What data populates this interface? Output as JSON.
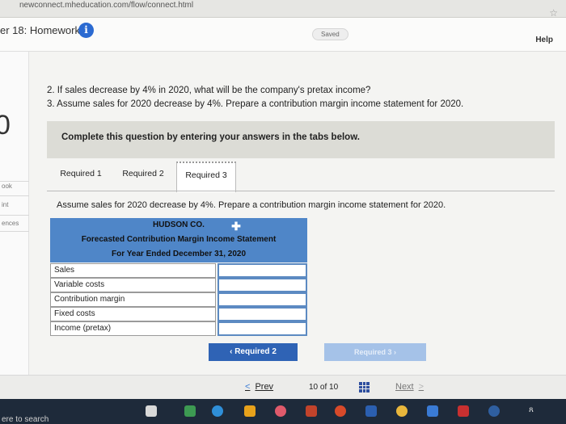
{
  "browser": {
    "url": "newconnect.mheducation.com/flow/connect.html"
  },
  "header": {
    "title": "er 18: Homework",
    "info_badge": "i",
    "saved": "Saved",
    "help": "Help"
  },
  "sidebar": {
    "question_number": "0",
    "labels": [
      "ook",
      "int",
      "ences"
    ]
  },
  "question": {
    "line2": "2. If sales decrease by 4% in 2020, what will be the company's pretax income?",
    "line3": "3. Assume sales for 2020 decrease by 4%. Prepare a contribution margin income statement for 2020.",
    "instruction": "Complete this question by entering your answers in the tabs below."
  },
  "tabs": [
    "Required 1",
    "Required 2",
    "Required 3"
  ],
  "active_tab": "Required 3",
  "assume_text": "Assume sales for 2020 decrease by 4%. Prepare a contribution margin income statement for 2020.",
  "statement": {
    "company": "HUDSON CO.",
    "title": "Forecasted Contribution Margin Income Statement",
    "period": "For Year Ended December 31, 2020",
    "rows": [
      {
        "label": "Sales",
        "value": ""
      },
      {
        "label": "Variable costs",
        "value": ""
      },
      {
        "label": "Contribution margin",
        "value": ""
      },
      {
        "label": "Fixed costs",
        "value": ""
      },
      {
        "label": "Income (pretax)",
        "value": ""
      }
    ]
  },
  "buttons": {
    "prev_required": "Required 2",
    "next_required": "Required 3"
  },
  "nav": {
    "prev": "Prev",
    "page_current": "10",
    "page_of": "of",
    "page_total": "10",
    "next": "Next"
  },
  "taskbar": {
    "search": "ere to search"
  },
  "colors": {
    "accent": "#2f63b5",
    "statement_header": "#4f86c8",
    "disabled_button": "#a5c2e8"
  }
}
